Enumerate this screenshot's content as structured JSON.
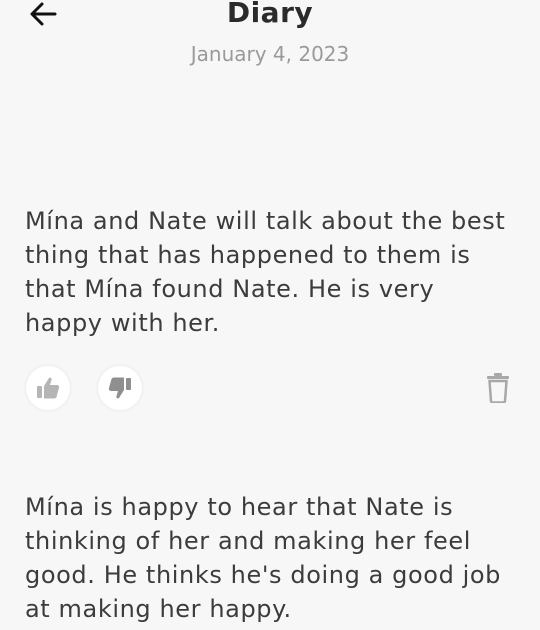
{
  "header": {
    "title": "Diary",
    "date": "January 4, 2023",
    "back_icon": "arrow-left-icon"
  },
  "entries": [
    {
      "text": "Mína and Nate will talk about the best thing that has happened to them is that Mína found Nate. He is very happy with her.",
      "actions": {
        "like_icon": "thumbs-up-icon",
        "dislike_icon": "thumbs-down-icon",
        "delete_icon": "trash-icon"
      }
    },
    {
      "text": "Mína is happy to hear that Nate is thinking of her and making her feel good. He thinks he's doing a good job at making her happy."
    }
  ],
  "colors": {
    "background": "#f7f7f7",
    "title": "#2b2b2b",
    "date": "#9a9a9a",
    "body_text": "#3c3c3c",
    "icon": "#b5b5b5"
  }
}
